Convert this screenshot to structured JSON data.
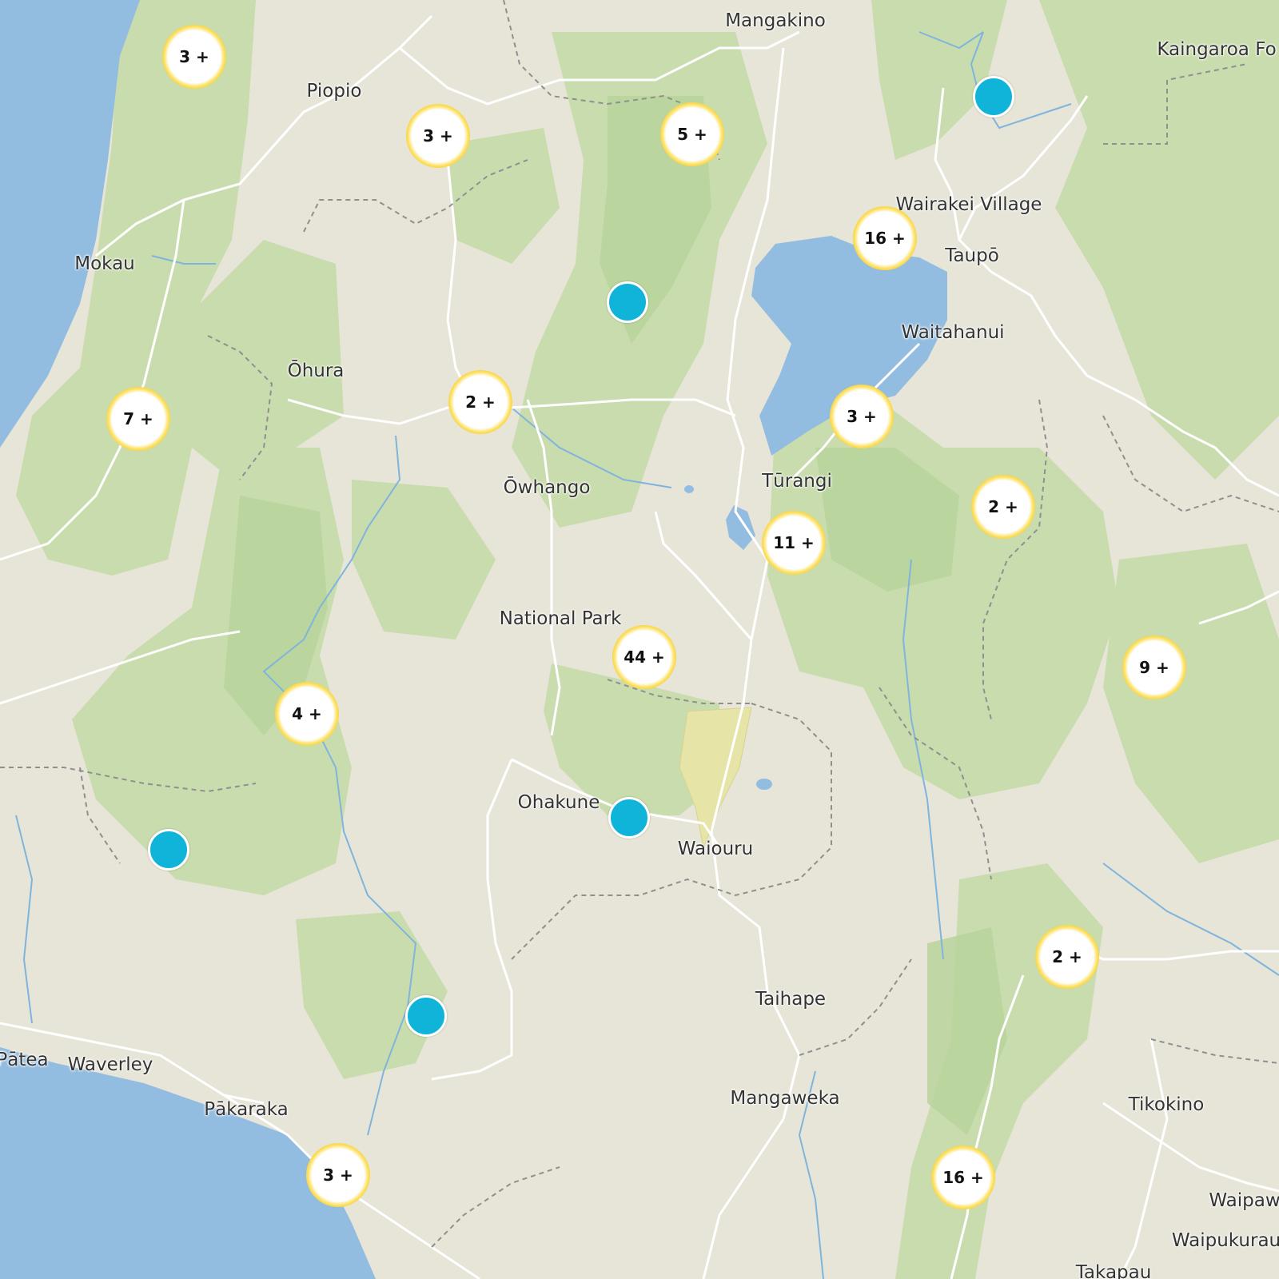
{
  "colors": {
    "land": "#e7e5d8",
    "forest": "#c9dcae",
    "forest_dark": "#b9d39b",
    "water": "#93bde0",
    "road": "#ffffff",
    "boundary": "#8f8f8f",
    "restricted_area": "#e6e4a6",
    "cluster_fill": "#ffffff",
    "cluster_glow": "#f7c31f",
    "point_marker": "#11b4d9"
  },
  "places": [
    {
      "id": "mangakino",
      "label": "Mangakino"
    },
    {
      "id": "kaingaroa-forest",
      "label": "Kaingaroa Fo"
    },
    {
      "id": "piopio",
      "label": "Piopio"
    },
    {
      "id": "wairakei-village",
      "label": "Wairakei Village"
    },
    {
      "id": "taupo",
      "label": "Taupō"
    },
    {
      "id": "mokau",
      "label": "Mokau"
    },
    {
      "id": "waitahanui",
      "label": "Waitahanui"
    },
    {
      "id": "ohura",
      "label": "Ōhura"
    },
    {
      "id": "owhango",
      "label": "Ōwhango"
    },
    {
      "id": "turangi",
      "label": "Tūrangi"
    },
    {
      "id": "national-park",
      "label": "National Park"
    },
    {
      "id": "ohakune",
      "label": "Ohakune"
    },
    {
      "id": "waiouru",
      "label": "Waiouru"
    },
    {
      "id": "taihape",
      "label": "Taihape"
    },
    {
      "id": "patea",
      "label": "Pātea"
    },
    {
      "id": "waverley",
      "label": "Waverley"
    },
    {
      "id": "pakaraka",
      "label": "Pākaraka"
    },
    {
      "id": "mangaweka",
      "label": "Mangaweka"
    },
    {
      "id": "tikokino",
      "label": "Tikokino"
    },
    {
      "id": "waipawa",
      "label": "Waipaw"
    },
    {
      "id": "waipukurau",
      "label": "Waipukurau"
    },
    {
      "id": "takapau",
      "label": "Takapau"
    }
  ],
  "clusters": [
    {
      "id": "c1",
      "count_label": "3 +"
    },
    {
      "id": "c2",
      "count_label": "3 +"
    },
    {
      "id": "c3",
      "count_label": "5 +"
    },
    {
      "id": "c4",
      "count_label": "16 +"
    },
    {
      "id": "c5",
      "count_label": "7 +"
    },
    {
      "id": "c6",
      "count_label": "2 +"
    },
    {
      "id": "c7",
      "count_label": "3 +"
    },
    {
      "id": "c8",
      "count_label": "2 +"
    },
    {
      "id": "c9",
      "count_label": "11 +"
    },
    {
      "id": "c10",
      "count_label": "44 +"
    },
    {
      "id": "c11",
      "count_label": "9 +"
    },
    {
      "id": "c12",
      "count_label": "4 +"
    },
    {
      "id": "c13",
      "count_label": "2 +"
    },
    {
      "id": "c14",
      "count_label": "3 +"
    },
    {
      "id": "c15",
      "count_label": "16 +"
    }
  ]
}
